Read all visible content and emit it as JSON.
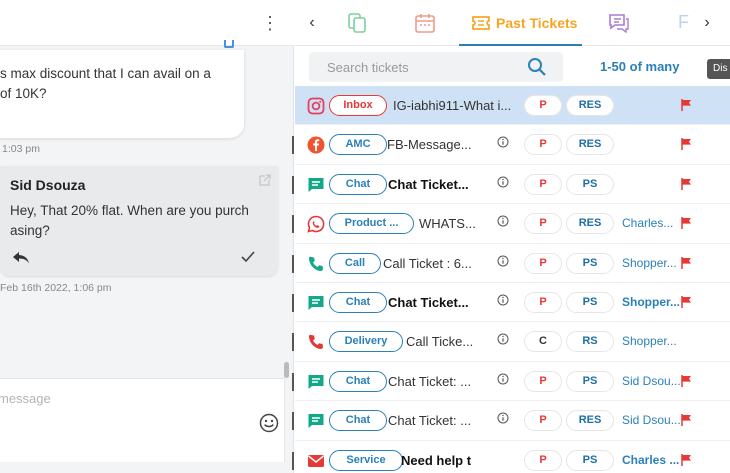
{
  "chat": {
    "incoming_message": "s max discount that I can avail on a of 10K?",
    "incoming_time": "1:03 pm",
    "outgoing_sender": "Sid Dsouza",
    "outgoing_message": "Hey, That 20% flat. When are you purch asing?",
    "outgoing_time": "Feb 16th 2022, 1:06 pm",
    "composer_placeholder": "message"
  },
  "tabs": {
    "active_label": "Past Tickets",
    "partial_label": "F"
  },
  "search": {
    "placeholder": "Search tickets"
  },
  "paging": "1-50 of many",
  "tooltip_partial": "Dis",
  "tickets": [
    {
      "channel": "instagram",
      "tag": "Inbox",
      "title": "IG-iabhi911-What i...",
      "bold": false,
      "priority": "P",
      "status": "RES",
      "agent": "",
      "flag": true,
      "info": false,
      "selected": true
    },
    {
      "channel": "facebook",
      "tag": "AMC",
      "title": "FB-Message...",
      "bold": false,
      "priority": "P",
      "status": "RES",
      "agent": "",
      "flag": true,
      "info": true,
      "selected": false
    },
    {
      "channel": "chat",
      "tag": "Chat",
      "title": "Chat Ticket...",
      "bold": true,
      "priority": "P",
      "status": "PS",
      "agent": "",
      "flag": true,
      "info": true,
      "selected": false
    },
    {
      "channel": "whatsapp",
      "tag": "Product ...",
      "title": "WHATS...",
      "bold": false,
      "priority": "P",
      "status": "RES",
      "agent": "Charles...",
      "flag": true,
      "info": true,
      "selected": false
    },
    {
      "channel": "call",
      "tag": "Call",
      "title": "Call Ticket : 6...",
      "bold": false,
      "priority": "P",
      "status": "PS",
      "agent": "Shopper...",
      "flag": true,
      "info": true,
      "selected": false
    },
    {
      "channel": "chat",
      "tag": "Chat",
      "title": "Chat Ticket...",
      "bold": true,
      "priority": "P",
      "status": "PS",
      "agent": "Shopper...",
      "agent_bold": true,
      "flag": true,
      "info": true,
      "selected": false
    },
    {
      "channel": "call-red",
      "tag": "Delivery",
      "title": "Call Ticke...",
      "bold": false,
      "priority": "C",
      "status": "RS",
      "agent": "Shopper...",
      "flag": false,
      "info": true,
      "selected": false
    },
    {
      "channel": "chat",
      "tag": "Chat",
      "title": "Chat Ticket: ...",
      "bold": false,
      "priority": "P",
      "status": "PS",
      "agent": "Sid Dsou...",
      "flag": true,
      "info": true,
      "selected": false
    },
    {
      "channel": "chat",
      "tag": "Chat",
      "title": "Chat Ticket: ...",
      "bold": false,
      "priority": "P",
      "status": "RES",
      "agent": "Sid Dsou...",
      "flag": true,
      "info": true,
      "selected": false
    },
    {
      "channel": "email",
      "tag": "Service",
      "title": "Need help t",
      "bold": true,
      "priority": "P",
      "status": "PS",
      "agent": "Charles ...",
      "agent_bold": true,
      "flag": true,
      "info": false,
      "selected": false
    }
  ]
}
